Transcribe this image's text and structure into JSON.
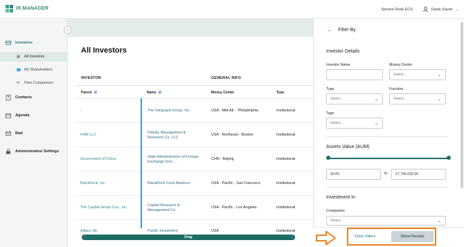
{
  "app": {
    "logo_text": "IR.MANAGER"
  },
  "header": {
    "service": "Service Desk ECS",
    "user_name": "Davis Xavier"
  },
  "sidebar": {
    "items": [
      {
        "label": "Investors",
        "icon": "investors-icon"
      },
      {
        "label": "Contacts",
        "icon": "contacts-icon"
      },
      {
        "label": "Agenda",
        "icon": "agenda-icon"
      },
      {
        "label": "Mail",
        "icon": "mail-icon"
      },
      {
        "label": "Administration Settings",
        "icon": "lock-icon"
      }
    ],
    "sub_items": [
      {
        "label": "All Investors",
        "active": true
      },
      {
        "label": "My Shareholders",
        "active": false
      },
      {
        "label": "Peer Comparison",
        "active": false
      }
    ]
  },
  "main": {
    "title": "All Investors",
    "groups": {
      "investor": "INVESTOR",
      "general": "GENERAL INFO"
    },
    "columns": {
      "parent": "Parent",
      "name": "Name",
      "money_center": "Money Center",
      "type": "Type"
    },
    "rows": [
      {
        "parent": "-",
        "name": "The Vanguard Group, Inc.",
        "money_center": "USA - Mid-Atl. - Philadelphia",
        "type": "Institutional"
      },
      {
        "parent": "FMR LLC",
        "name": "Fidelity Management & Research Co. LLC",
        "money_center": "USA - Northeast - Boston",
        "type": "Institutional"
      },
      {
        "parent": "Government of China",
        "name": "State Administration of Foreign Exchange (Invt ...",
        "money_center": "CHN - Beijing",
        "type": "Institutional"
      },
      {
        "parent": "BlackRock, Inc.",
        "name": "BlackRock Fund Advisors",
        "money_center": "USA - Pacific - San Francisco",
        "type": "Institutional"
      },
      {
        "parent": "The Capital Group Cos., Inc.",
        "name": "Capital Research & Management Co.",
        "money_center": "USA - Pacific - Los Angeles",
        "type": "Institutional"
      },
      {
        "parent": "Allianz SE",
        "name": "Pacific Investment",
        "money_center": "USA",
        "type": "Institutional"
      }
    ],
    "scrollbar_label": "Drag"
  },
  "filter": {
    "title": "Filter By",
    "investor_details": "Investor Details",
    "investor_name_label": "Investor Name",
    "investor_name_value": "",
    "money_center_label": "Money Center",
    "money_center_placeholder": "Select...",
    "type_label": "Type",
    "type_placeholder": "Select...",
    "function_label": "Function",
    "function_placeholder": "Select...",
    "tags_label": "Tags",
    "tags_placeholder": "Select...",
    "assets_title": "Assets Value (AUM)",
    "assets_min": "€0.00",
    "assets_max": "€7,796,092.00",
    "to_label": "to",
    "investment_title": "Investment In",
    "companies_label": "Companies",
    "companies_placeholder": "Select...",
    "clear_label": "Clear Filters",
    "show_label": "Show Results"
  },
  "colors": {
    "accent": "#1e6c66",
    "highlight": "#f07f1e",
    "link": "#2d8a8a"
  }
}
